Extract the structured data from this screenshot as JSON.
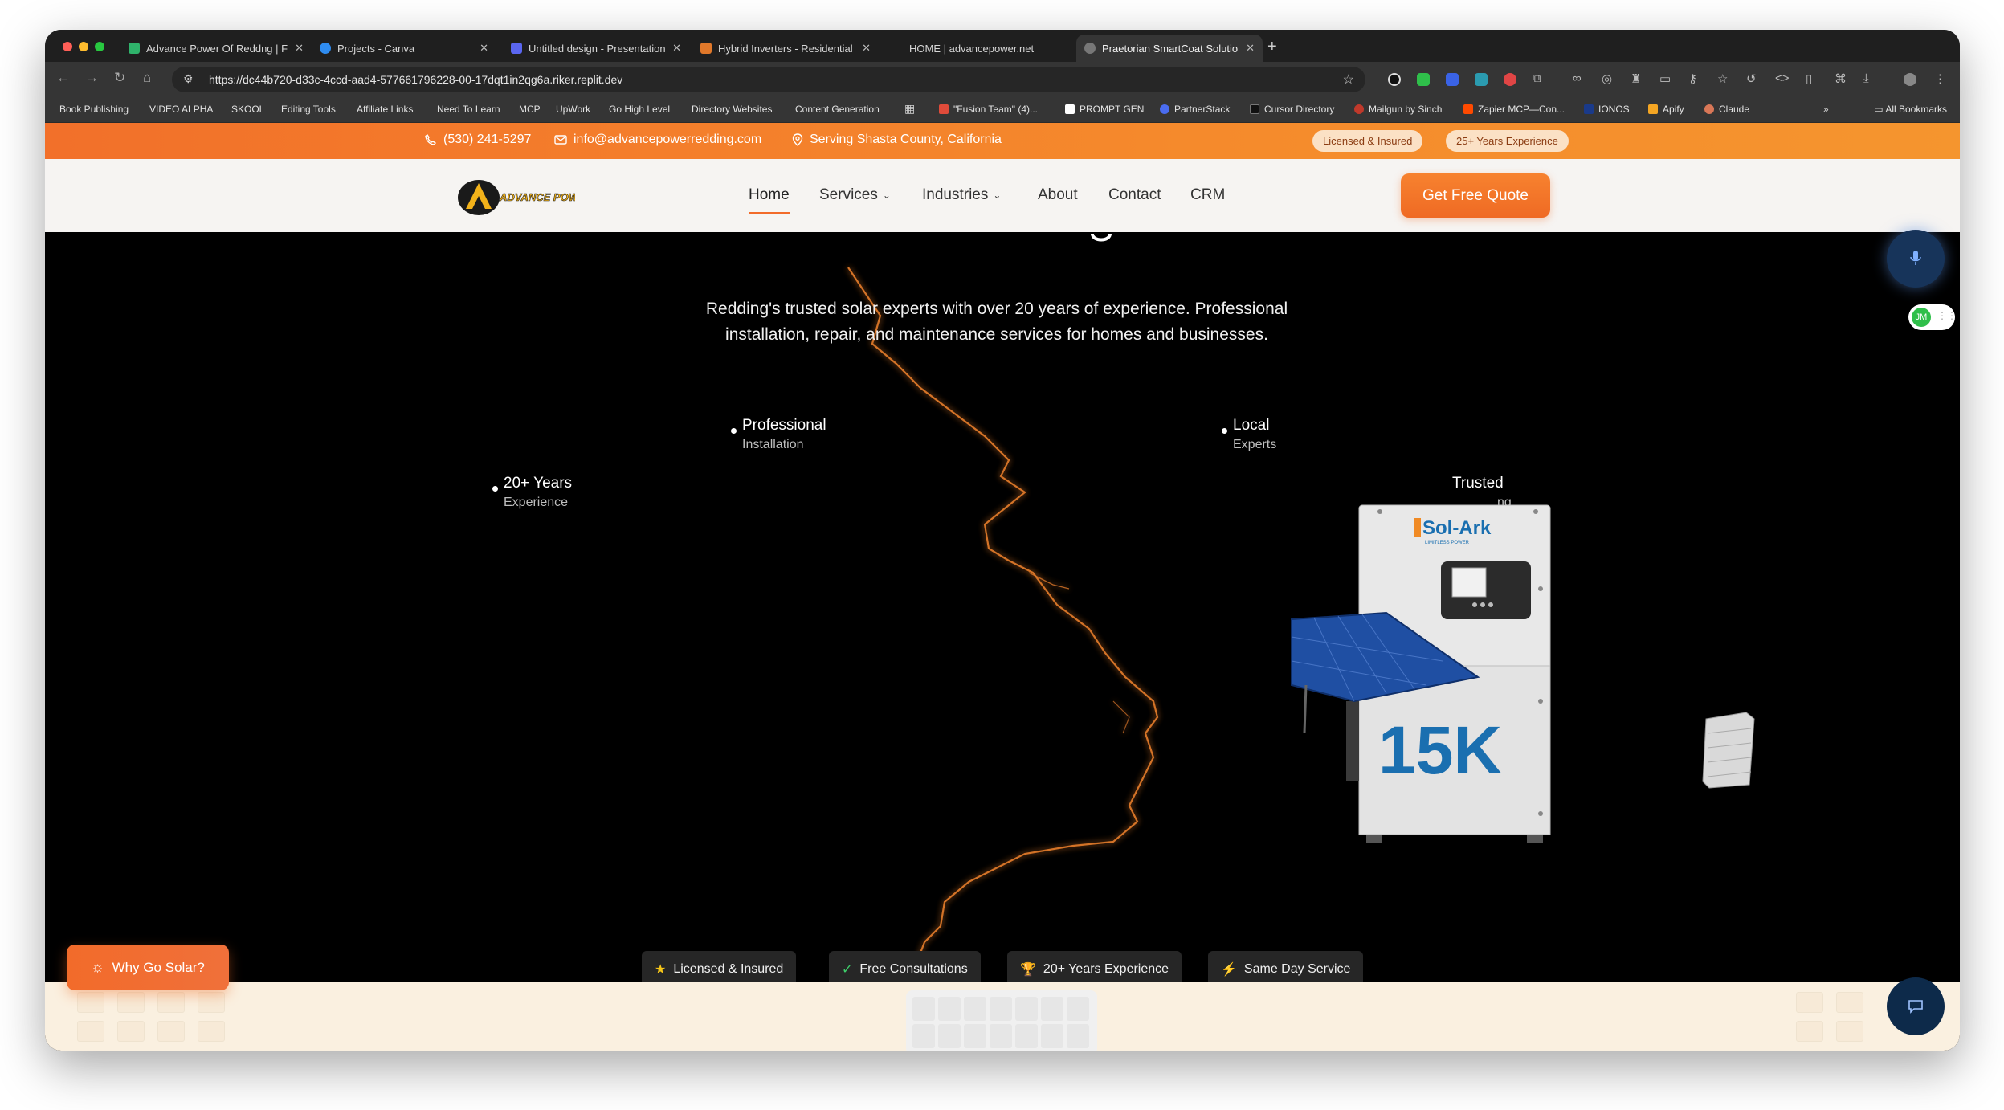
{
  "browser": {
    "tabs": [
      {
        "title": "Advance Power Of Reddng | F",
        "active": false
      },
      {
        "title": "Projects - Canva",
        "active": false
      },
      {
        "title": "Untitled design - Presentation",
        "active": false
      },
      {
        "title": "Hybrid Inverters - Residential",
        "active": false
      },
      {
        "title": "HOME | advancepower.net",
        "active": false
      },
      {
        "title": "Praetorian SmartCoat Solutio",
        "active": true
      }
    ],
    "new_tab_label": "+",
    "url": "https://dc44b720-d33c-4ccd-aad4-577661796228-00-17dqt1in2qg6a.riker.replit.dev",
    "bookmarks": [
      "Book Publishing",
      "VIDEO ALPHA",
      "SKOOL",
      "Editing Tools",
      "Affiliate Links",
      "Need To Learn",
      "MCP",
      "UpWork",
      "Go High Level",
      "Directory Websites",
      "Content Generation",
      "\"Fusion Team\" (4)...",
      "PROMPT GEN",
      "PartnerStack",
      "Cursor Directory",
      "Mailgun by Sinch",
      "Zapier MCP—Con...",
      "IONOS",
      "Apify",
      "Claude"
    ],
    "bookmark_overflow": "»",
    "all_bookmarks": "All Bookmarks"
  },
  "topbar": {
    "phone": "(530) 241-5297",
    "email": "info@advancepowerredding.com",
    "location": "Serving Shasta County, California",
    "badges": [
      "Licensed & Insured",
      "25+ Years Experience"
    ]
  },
  "header": {
    "logo_text": "ADVANCE POWER REDDING",
    "nav": [
      {
        "label": "Home",
        "active": true,
        "dropdown": false
      },
      {
        "label": "Services",
        "active": false,
        "dropdown": true
      },
      {
        "label": "Industries",
        "active": false,
        "dropdown": true
      },
      {
        "label": "About",
        "active": false,
        "dropdown": false
      },
      {
        "label": "Contact",
        "active": false,
        "dropdown": false
      },
      {
        "label": "CRM",
        "active": false,
        "dropdown": false
      }
    ],
    "cta": "Get Free Quote"
  },
  "hero": {
    "subtitle_line1": "Redding's trusted solar experts with over 20 years of experience. Professional",
    "subtitle_line2": "installation, repair, and maintenance services for homes and businesses.",
    "features": [
      {
        "title": "20+ Years",
        "sub": "Experience"
      },
      {
        "title": "Professional",
        "sub": "Installation"
      },
      {
        "title": "Local",
        "sub": "Experts"
      },
      {
        "title": "Trusted",
        "sub": "ng"
      }
    ],
    "inverter_brand": "Sol-Ark",
    "inverter_tagline": "LIMITLESS POWER",
    "inverter_model": "15K"
  },
  "pills": [
    {
      "icon": "star",
      "label": "Licensed & Insured"
    },
    {
      "icon": "check",
      "label": "Free Consultations"
    },
    {
      "icon": "trophy",
      "label": "20+ Years Experience"
    },
    {
      "icon": "bolt",
      "label": "Same Day Service"
    }
  ],
  "floating": {
    "why_solar": "Why Go Solar?",
    "jm_label": "JM"
  },
  "colors": {
    "accent": "#f26b2a",
    "topbar_badge_bg": "#fbe1c5",
    "hero_bg": "#000000",
    "inverter_blue": "#1a6fb0"
  }
}
